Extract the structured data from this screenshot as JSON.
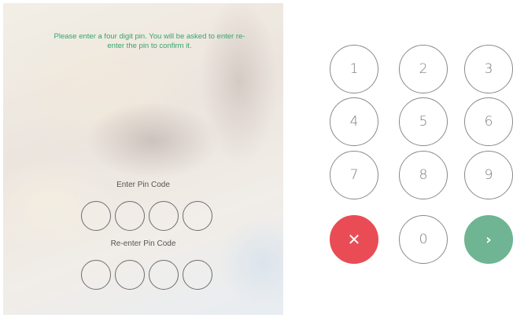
{
  "instructions": "Please enter a four digit pin. You will be asked to enter re-enter the pin to confirm it.",
  "enter_label": "Enter Pin Code",
  "reenter_label": "Re-enter Pin Code",
  "keypad": {
    "keys": [
      "1",
      "2",
      "3",
      "4",
      "5",
      "6",
      "7",
      "8",
      "9",
      "0"
    ],
    "cancel_icon": "✕",
    "next_icon": "›"
  },
  "colors": {
    "instructions_text": "#3aa36b",
    "cancel": "#ea4c55",
    "next": "#6fb593"
  },
  "icons": {
    "cancel": "close-icon",
    "next": "chevron-right-icon"
  }
}
